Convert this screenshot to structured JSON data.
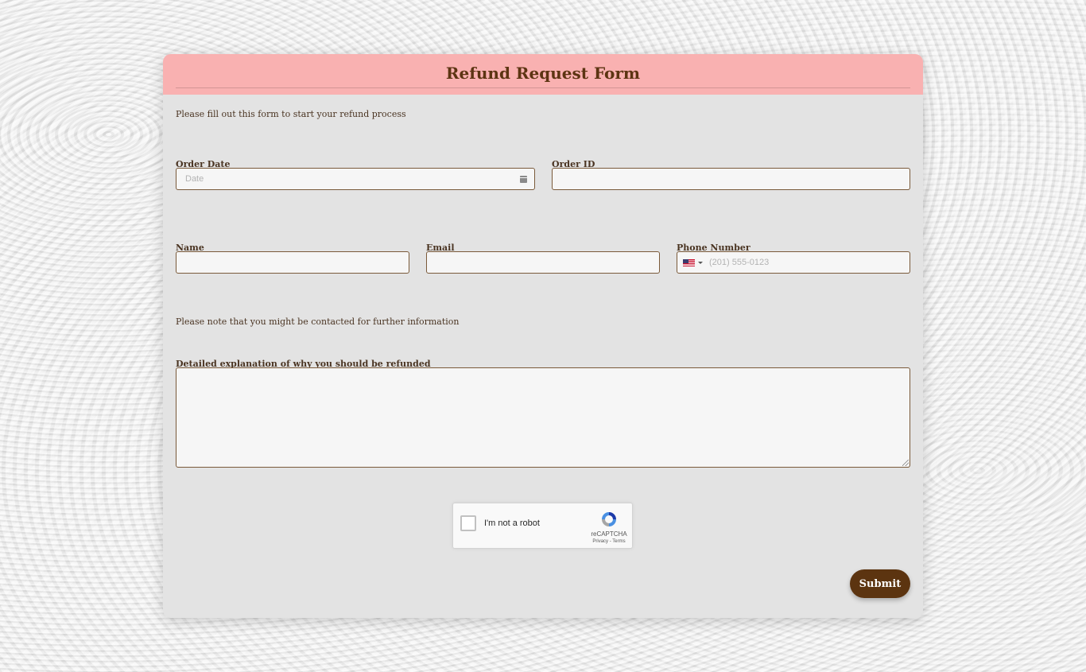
{
  "form": {
    "title": "Refund Request Form",
    "intro": "Please fill out this form to start your refund process",
    "note": "Please note that you might be contacted for further information",
    "header_color": "#f9b1b1",
    "accent_color": "#5c3410"
  },
  "fields": {
    "order_date": {
      "label": "Order Date",
      "placeholder": "Date",
      "value": "",
      "icon": "calendar-icon"
    },
    "order_id": {
      "label": "Order ID",
      "value": ""
    },
    "name": {
      "label": "Name",
      "value": ""
    },
    "email": {
      "label": "Email",
      "value": ""
    },
    "phone": {
      "label": "Phone Number",
      "placeholder": "(201) 555-0123",
      "country_flag": "us-flag-icon",
      "value": ""
    },
    "explanation": {
      "label": "Detailed explanation of why you should be refunded",
      "value": ""
    }
  },
  "captcha": {
    "label": "I'm not a robot",
    "brand": "reCAPTCHA",
    "links": "Privacy - Terms",
    "checked": false
  },
  "submit": {
    "label": "Submit"
  }
}
